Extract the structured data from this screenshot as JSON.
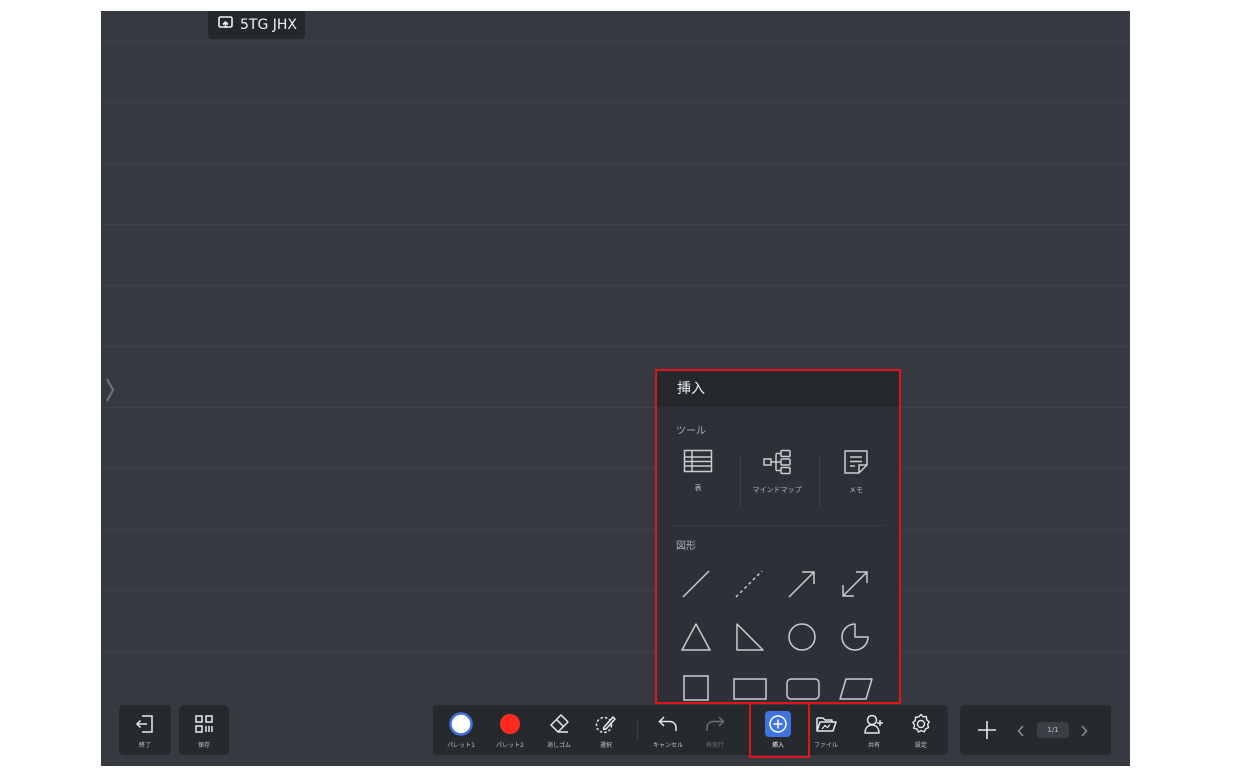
{
  "room": {
    "code": "5TG JHX",
    "icon": "screen-share-icon"
  },
  "insert_panel": {
    "title": "挿入",
    "tools_section": "ツール",
    "tools": [
      {
        "label": "表",
        "icon": "table-icon"
      },
      {
        "label": "マインドマップ",
        "icon": "mindmap-icon"
      },
      {
        "label": "メモ",
        "icon": "memo-icon"
      }
    ],
    "shapes_section": "図形",
    "shapes": [
      "line",
      "dashed-line",
      "arrow",
      "double-arrow",
      "triangle",
      "right-triangle",
      "circle",
      "sector",
      "square",
      "rectangle",
      "rounded-rectangle",
      "parallelogram"
    ]
  },
  "toolbar_left": {
    "exit_label": "終了",
    "save_label": "保存"
  },
  "toolbar_main": {
    "palette1": "パレット1",
    "palette2": "パレット2",
    "eraser": "消しゴム",
    "select": "選択",
    "undo": "キャンセル",
    "redo": "再実行",
    "insert": "挿入",
    "file": "ファイル",
    "share": "共有",
    "settings": "設定"
  },
  "pager": {
    "page": "1/1"
  },
  "colors": {
    "board": "#363a40",
    "panel": "#26292e",
    "accent": "#3f74e0",
    "palette2": "#ff2b21",
    "highlight": "#e11515"
  }
}
